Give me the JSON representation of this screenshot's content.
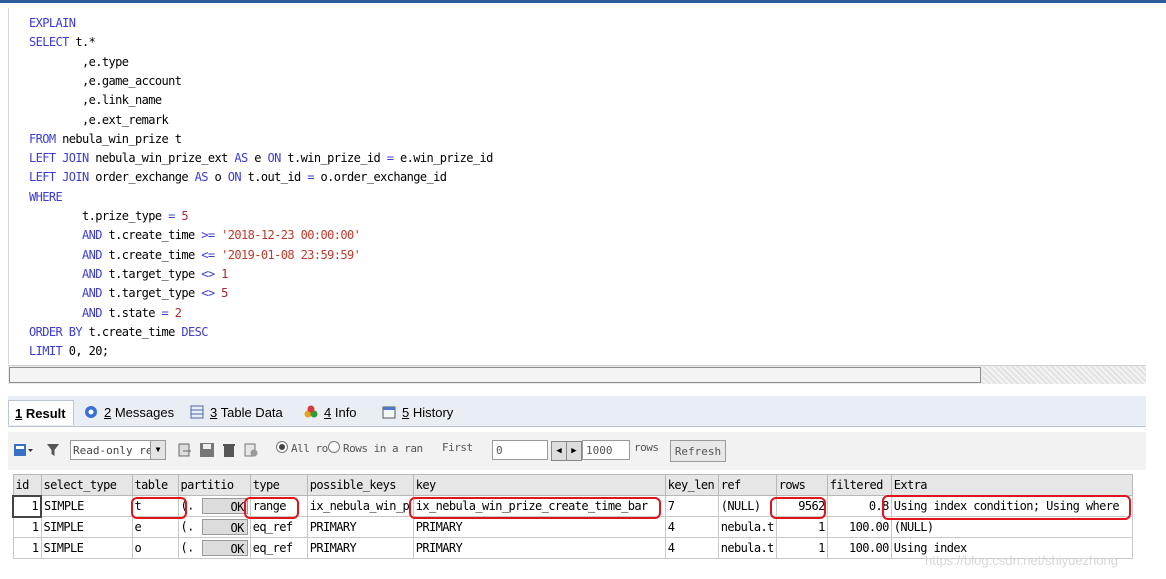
{
  "editor": {
    "lines": [
      {
        "indent": "",
        "parts": [
          {
            "t": "EXPLAIN",
            "c": "kw"
          }
        ]
      },
      {
        "indent": "",
        "parts": [
          {
            "t": "SELECT",
            "c": "kw"
          },
          {
            "t": " t.*",
            "c": ""
          }
        ]
      },
      {
        "indent": "        ",
        "parts": [
          {
            "t": ",e.type",
            "c": ""
          }
        ]
      },
      {
        "indent": "        ",
        "parts": [
          {
            "t": ",e.game_account",
            "c": ""
          }
        ]
      },
      {
        "indent": "        ",
        "parts": [
          {
            "t": ",e.link_name",
            "c": ""
          }
        ]
      },
      {
        "indent": "        ",
        "parts": [
          {
            "t": ",e.ext_remark",
            "c": ""
          }
        ]
      },
      {
        "indent": "",
        "parts": [
          {
            "t": "FROM",
            "c": "kw"
          },
          {
            "t": " nebula_win_prize t",
            "c": ""
          }
        ]
      },
      {
        "indent": "",
        "parts": [
          {
            "t": "LEFT JOIN",
            "c": "kw"
          },
          {
            "t": " nebula_win_prize_ext ",
            "c": ""
          },
          {
            "t": "AS",
            "c": "kw"
          },
          {
            "t": " e ",
            "c": ""
          },
          {
            "t": "ON",
            "c": "kw"
          },
          {
            "t": " t.win_prize_id ",
            "c": ""
          },
          {
            "t": "=",
            "c": "op"
          },
          {
            "t": " e.win_prize_id",
            "c": ""
          }
        ]
      },
      {
        "indent": "",
        "parts": [
          {
            "t": "LEFT JOIN",
            "c": "kw"
          },
          {
            "t": " order_exchange ",
            "c": ""
          },
          {
            "t": "AS",
            "c": "kw"
          },
          {
            "t": " o ",
            "c": ""
          },
          {
            "t": "ON",
            "c": "kw"
          },
          {
            "t": " t.out_id ",
            "c": ""
          },
          {
            "t": "=",
            "c": "op"
          },
          {
            "t": " o.order_exchange_id",
            "c": ""
          }
        ]
      },
      {
        "indent": "",
        "parts": [
          {
            "t": "WHERE",
            "c": "kw"
          }
        ]
      },
      {
        "indent": "        ",
        "parts": [
          {
            "t": "t.prize_type ",
            "c": ""
          },
          {
            "t": "=",
            "c": "op"
          },
          {
            "t": " 5",
            "c": "num"
          }
        ]
      },
      {
        "indent": "        ",
        "parts": [
          {
            "t": "AND",
            "c": "kw"
          },
          {
            "t": " t.create_time ",
            "c": ""
          },
          {
            "t": ">=",
            "c": "op"
          },
          {
            "t": " '2018-12-23 00:00:00'",
            "c": "str"
          }
        ]
      },
      {
        "indent": "        ",
        "parts": [
          {
            "t": "AND",
            "c": "kw"
          },
          {
            "t": " t.create_time ",
            "c": ""
          },
          {
            "t": "<=",
            "c": "op"
          },
          {
            "t": " '2019-01-08 23:59:59'",
            "c": "str"
          }
        ]
      },
      {
        "indent": "        ",
        "parts": [
          {
            "t": "AND",
            "c": "kw"
          },
          {
            "t": " t.target_type ",
            "c": ""
          },
          {
            "t": "<>",
            "c": "op"
          },
          {
            "t": " 1",
            "c": "num"
          }
        ]
      },
      {
        "indent": "        ",
        "parts": [
          {
            "t": "AND",
            "c": "kw"
          },
          {
            "t": " t.target_type ",
            "c": ""
          },
          {
            "t": "<>",
            "c": "op"
          },
          {
            "t": " 5",
            "c": "num"
          }
        ]
      },
      {
        "indent": "        ",
        "parts": [
          {
            "t": "AND",
            "c": "kw"
          },
          {
            "t": " t.state ",
            "c": ""
          },
          {
            "t": "=",
            "c": "op"
          },
          {
            "t": " 2",
            "c": "num"
          }
        ]
      },
      {
        "indent": "",
        "parts": [
          {
            "t": "ORDER BY",
            "c": "kw"
          },
          {
            "t": " t.create_time ",
            "c": ""
          },
          {
            "t": "DESC",
            "c": "kw"
          }
        ]
      },
      {
        "indent": "",
        "parts": [
          {
            "t": "LIMIT",
            "c": "kw"
          },
          {
            "t": " 0, 20;",
            "c": ""
          }
        ]
      }
    ]
  },
  "tabs": [
    {
      "key": "1",
      "label": " Result",
      "icon": "result-icon"
    },
    {
      "key": "2",
      "label": " Messages",
      "icon": "messages-icon"
    },
    {
      "key": "3",
      "label": " Table Data",
      "icon": "table-data-icon"
    },
    {
      "key": "4",
      "label": " Info",
      "icon": "info-icon"
    },
    {
      "key": "5",
      "label": " History",
      "icon": "history-icon"
    }
  ],
  "toolbar": {
    "mode_select": "Read-only res",
    "radio_all_rows": "All rov",
    "radio_rows_range": "Rows in a ran",
    "first_label": "First",
    "first_value": "0",
    "rows_value": "1000",
    "rows_label": "rows",
    "refresh_label": "Refresh"
  },
  "results": {
    "columns": [
      "id",
      "select_type",
      "table",
      "partitio",
      "type",
      "possible_keys",
      "key",
      "key_len",
      "ref",
      "rows",
      "filtered",
      "Extra"
    ],
    "rows": [
      {
        "id": "1",
        "select_type": "SIMPLE",
        "table": "t",
        "partitions": "(.",
        "ok": "OK",
        "type": "range",
        "possible_keys": "ix_nebula_win_p",
        "key": "ix_nebula_win_prize_create_time_bar",
        "key_len": "7",
        "ref": "(NULL)",
        "rows": "9562",
        "filtered": "0.8",
        "extra": "Using index condition; Using where"
      },
      {
        "id": "1",
        "select_type": "SIMPLE",
        "table": "e",
        "partitions": "(.",
        "ok": "OK",
        "type": "eq_ref",
        "possible_keys": "PRIMARY",
        "key": "PRIMARY",
        "key_len": "4",
        "ref": "nebula.t",
        "rows": "1",
        "filtered": "100.00",
        "extra": "(NULL)"
      },
      {
        "id": "1",
        "select_type": "SIMPLE",
        "table": "o",
        "partitions": "(.",
        "ok": "OK",
        "type": "eq_ref",
        "possible_keys": "PRIMARY",
        "key": "PRIMARY",
        "key_len": "4",
        "ref": "nebula.t",
        "rows": "1",
        "filtered": "100.00",
        "extra": "Using index"
      }
    ]
  },
  "watermark": "https://blog.csdn.net/shiyuezhong",
  "colors": {
    "keyword": "#3b3bd6",
    "string": "#c0392b",
    "highlight": "#e0141c"
  }
}
